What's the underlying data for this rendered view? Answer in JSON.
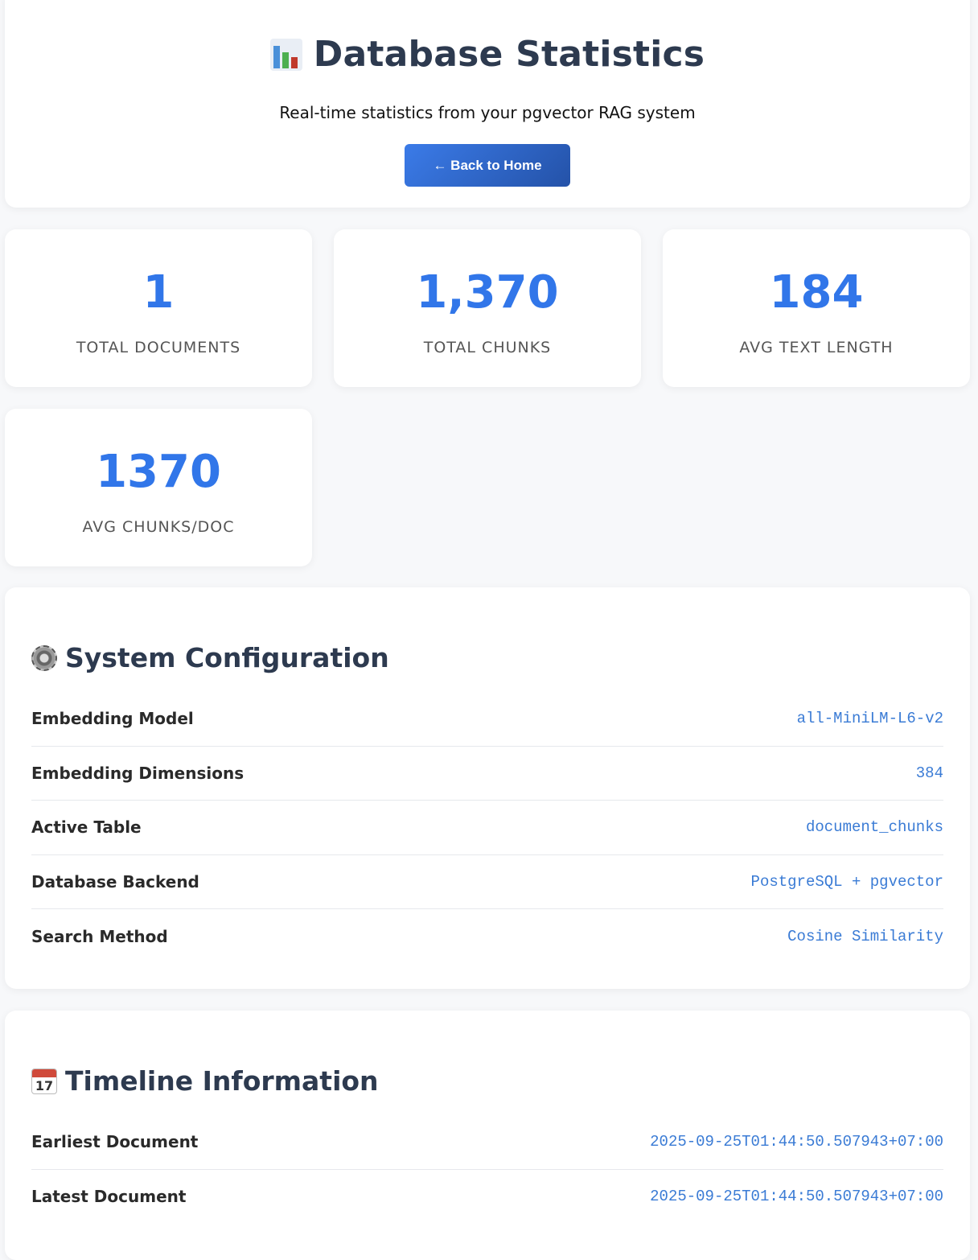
{
  "header": {
    "title": "Database Statistics",
    "subtitle": "Real-time statistics from your pgvector RAG system",
    "back_button": "← Back to Home",
    "icon": "bar-chart-icon"
  },
  "stats": [
    {
      "value": "1",
      "label": "Total Documents"
    },
    {
      "value": "1,370",
      "label": "Total Chunks"
    },
    {
      "value": "184",
      "label": "Avg Text Length"
    },
    {
      "value": "1370",
      "label": "Avg Chunks/Doc"
    }
  ],
  "config": {
    "title": "System Configuration",
    "icon": "gear-icon",
    "rows": [
      {
        "key": "Embedding Model",
        "value": "all-MiniLM-L6-v2"
      },
      {
        "key": "Embedding Dimensions",
        "value": "384"
      },
      {
        "key": "Active Table",
        "value": "document_chunks"
      },
      {
        "key": "Database Backend",
        "value": "PostgreSQL + pgvector"
      },
      {
        "key": "Search Method",
        "value": "Cosine Similarity"
      }
    ]
  },
  "timeline": {
    "title": "Timeline Information",
    "icon": "calendar-icon",
    "calendar_day": "17",
    "rows": [
      {
        "key": "Earliest Document",
        "value": "2025-09-25T01:44:50.507943+07:00"
      },
      {
        "key": "Latest Document",
        "value": "2025-09-25T01:44:50.507943+07:00"
      }
    ]
  },
  "colors": {
    "accent": "#3176e9",
    "value_text": "#3a7bd5",
    "title_text": "#2d3a4f",
    "background": "#f7f8fa"
  }
}
